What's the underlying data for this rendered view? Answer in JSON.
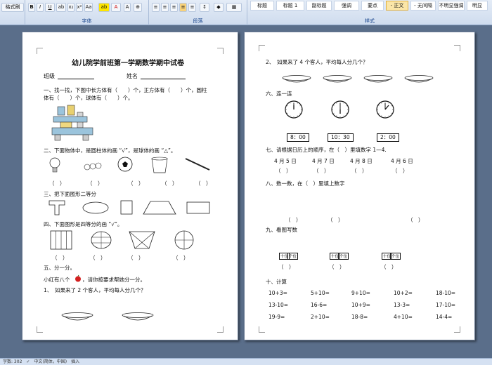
{
  "ribbon": {
    "clipboard_label": "格式刷",
    "font_group_label": "字体",
    "paragraph_group_label": "段落",
    "styles_group_label": "样式",
    "styles": [
      "标题",
      "标题 1",
      "副标题",
      "强调",
      "要点",
      "- 正文",
      "- 无间隔",
      "不明显强调",
      "明显"
    ]
  },
  "p1": {
    "title": "幼儿院学前班第一学期数学期中试卷",
    "class_label": "班级",
    "name_label": "姓名",
    "q1": "一、找一找，下图中长方体有（　　）个，正方体有（　　）个，圆柱",
    "q1b": "体有（　　）个，球体有（　　）个。",
    "q2": "二、下面物体中，是圆柱体的画 “√”，是球体的画 “△”。",
    "paren": "（　）",
    "q3": "三、把下面图形二等分",
    "q4": "四、下面图形是四等分的画 “√”。",
    "q5": "五、分一分。",
    "q5a1": "小红有八个",
    "q5a2": "，请你按要求帮她分一分。",
    "q5_1": "1、　如果来了 2 个客人，平均每人分几个？"
  },
  "p2": {
    "q5_2": "2、　如果来了 4 个客人，平均每人分几个？",
    "q6": "六、连一连",
    "times": [
      "8：00",
      "10：30",
      "2：00"
    ],
    "q7": "七、请根据日历上的顺序，在（　）里填数字 1—4.",
    "dates": [
      "4 月 5 日",
      "4 月 7 日",
      "4 月 8 日",
      "4 月 6 日"
    ],
    "q8": "八、数一数，在（　）里填上数字",
    "q9": "九、看图写数",
    "abacus_labels": [
      "十位",
      "个位"
    ],
    "q10": "十、计算",
    "calc": [
      [
        "10+3=",
        "5+10=",
        "9+10=",
        "10+2=",
        "18-10="
      ],
      [
        "13-10=",
        "16-6=",
        "10+9=",
        "13-3=",
        "17-10="
      ],
      [
        "19-9=",
        "2+10=",
        "18-8=",
        "4+10=",
        "14-4="
      ]
    ]
  },
  "status": {
    "text": "字数: 302　✓　中文(简体，中国)　插入"
  },
  "colors": {
    "ribbon": "#dce6f4",
    "desk": "#5a6e8a",
    "page": "#ffffff",
    "apple": "#d42020"
  }
}
